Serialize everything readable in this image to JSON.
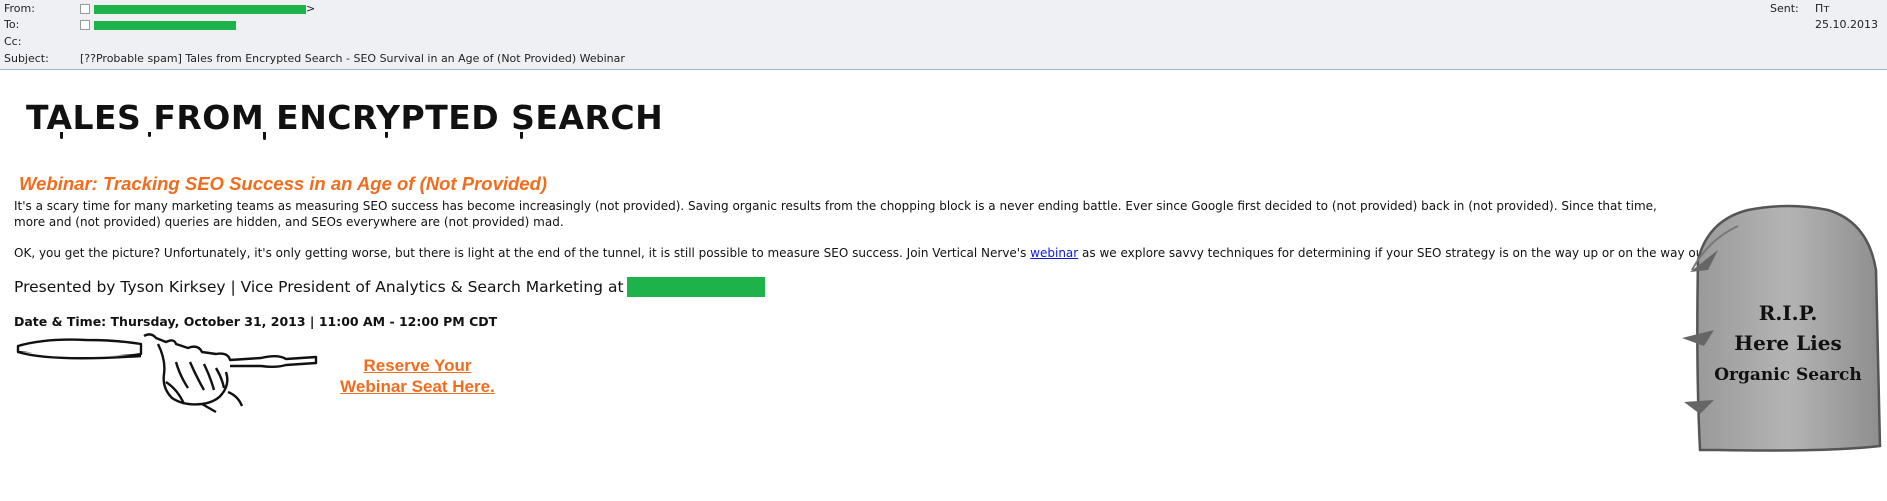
{
  "header": {
    "from_label": "From:",
    "to_label": "To:",
    "cc_label": "Cc:",
    "subject_label": "Subject:",
    "from_suffix": ">",
    "subject": "[??Probable spam] Tales from Encrypted Search - SEO Survival in an Age of  (Not Provided) Webinar",
    "sent_label": "Sent:",
    "sent_value": "Пт 25.10.2013",
    "redaction_color": "#1db34a"
  },
  "email": {
    "banner": "TALES FROM ENCRYPTED SEARCH",
    "webinar_title": "Webinar: Tracking SEO Success in an Age of (Not Provided)",
    "paragraph1": "It's a scary time for many marketing teams as measuring SEO success has become increasingly (not provided). Saving organic results from the chopping block is a never ending battle. Ever since Google first decided to (not provided) back in (not provided). Since that time, more and (not provided) queries are hidden, and SEOs everywhere are (not provided) mad.",
    "paragraph2_before": "OK, you get the picture? Unfortunately, it's only getting worse, but there is light at the end of the tunnel, it is still possible to measure SEO success. Join Vertical Nerve's ",
    "paragraph2_link": "webinar",
    "paragraph2_after": " as we explore savvy techniques for determining if your SEO strategy is on the way up or on the way out.",
    "presented_by": "Presented by Tyson Kirksey | Vice President of Analytics & Search Marketing at",
    "date_time": "Date & Time: Thursday, October 31, 2013 | 11:00 AM - 12:00 PM CDT",
    "reserve_line1": "Reserve Your",
    "reserve_line2": "Webinar Seat Here.",
    "tombstone_line1": "R.I.P.",
    "tombstone_line2": "Here Lies",
    "tombstone_line3": "Organic Search",
    "accent_color": "#f26c1e",
    "link_color": "#0b1bd9"
  }
}
